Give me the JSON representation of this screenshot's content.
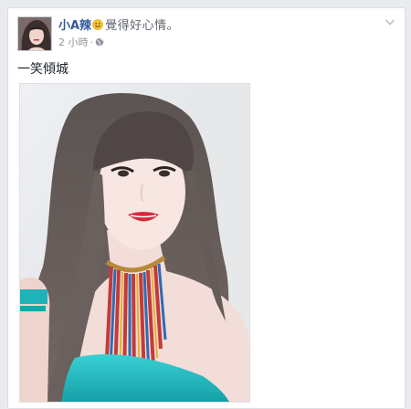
{
  "post": {
    "author": "小A辣",
    "feeling_text": "覺得好心情。",
    "timestamp": "2 小時",
    "separator": "·",
    "caption": "一笑傾城",
    "feeling_icon": "smiley-emoji-icon",
    "privacy_icon": "globe-icon",
    "menu_icon": "chevron-down-icon"
  },
  "colors": {
    "author_link": "#365899",
    "meta_text": "#90949c",
    "dress": "#20c0c4",
    "lips": "#d62a3a"
  }
}
